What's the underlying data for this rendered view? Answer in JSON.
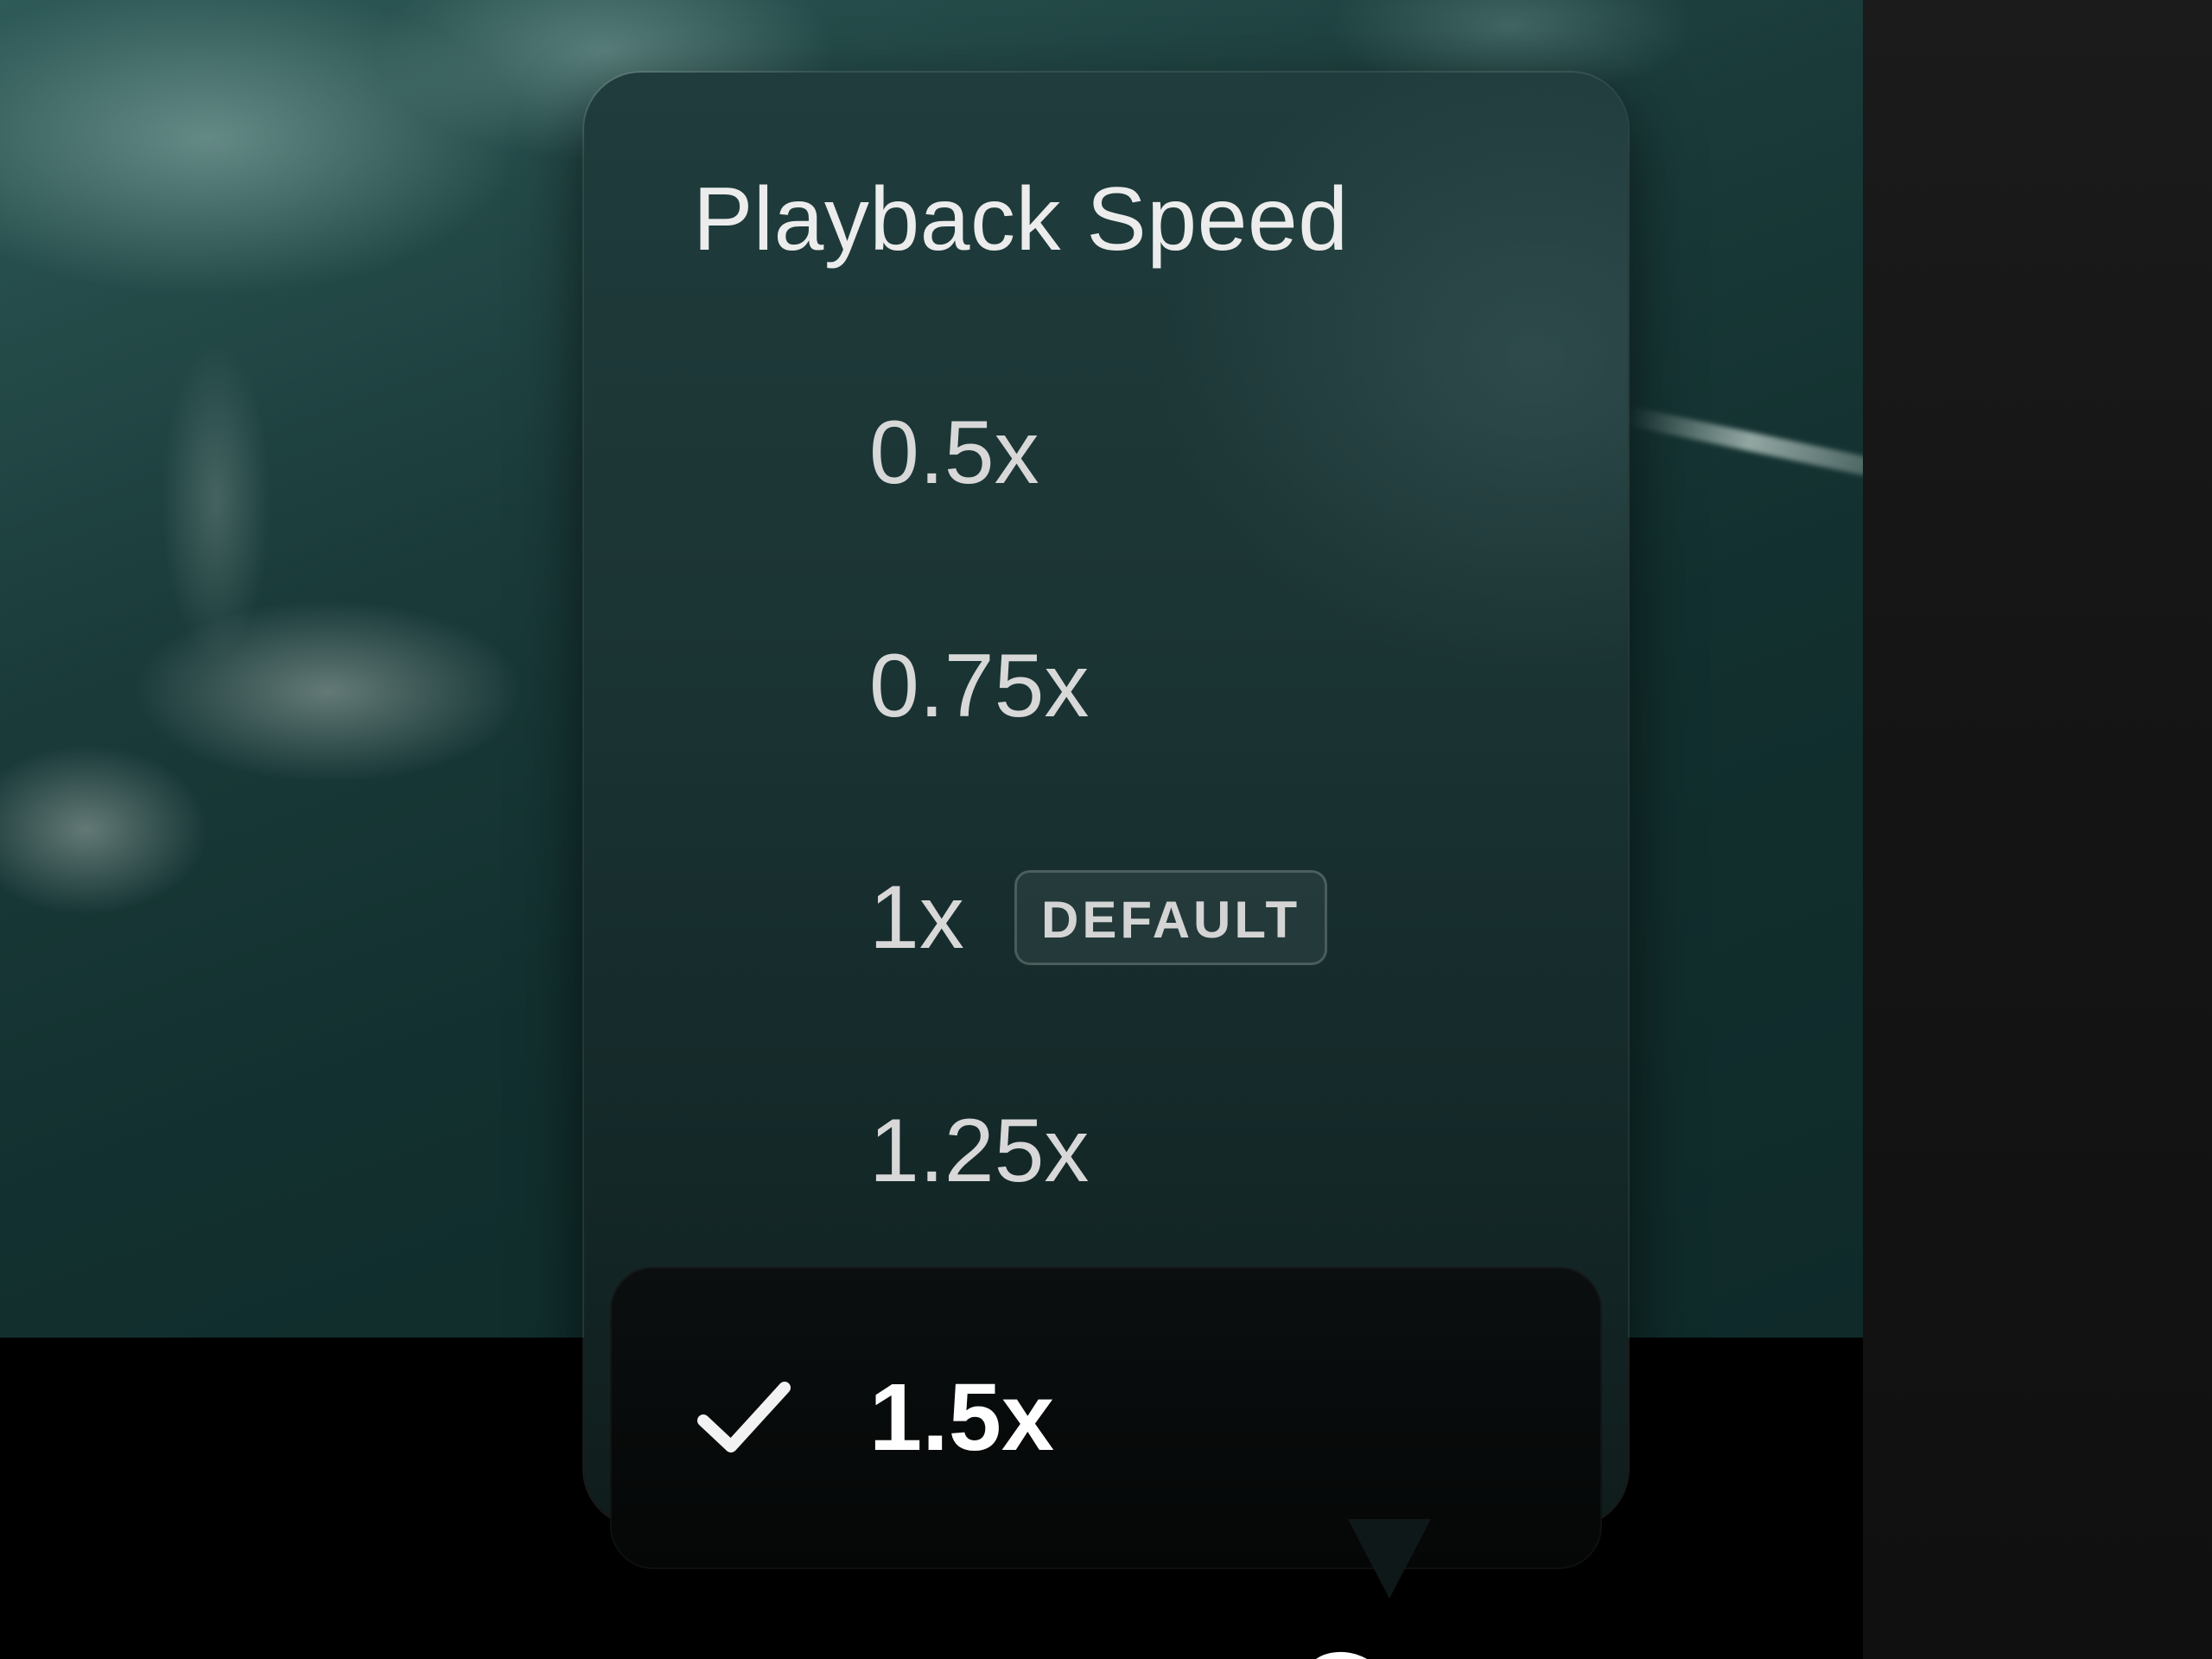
{
  "menu": {
    "title": "Playback Speed",
    "options": [
      {
        "label": "0.5x",
        "selected": false
      },
      {
        "label": "0.75x",
        "selected": false
      },
      {
        "label": "1x",
        "selected": false,
        "badge": "DEFAULT"
      },
      {
        "label": "1.25x",
        "selected": false
      },
      {
        "label": "1.5x",
        "selected": true
      }
    ],
    "selected_icon": "checkmark-icon"
  },
  "colors": {
    "menu_background": "#1a3232",
    "selected_row": "#050707",
    "text": "#d8d8d8",
    "selected_text": "#ffffff"
  }
}
